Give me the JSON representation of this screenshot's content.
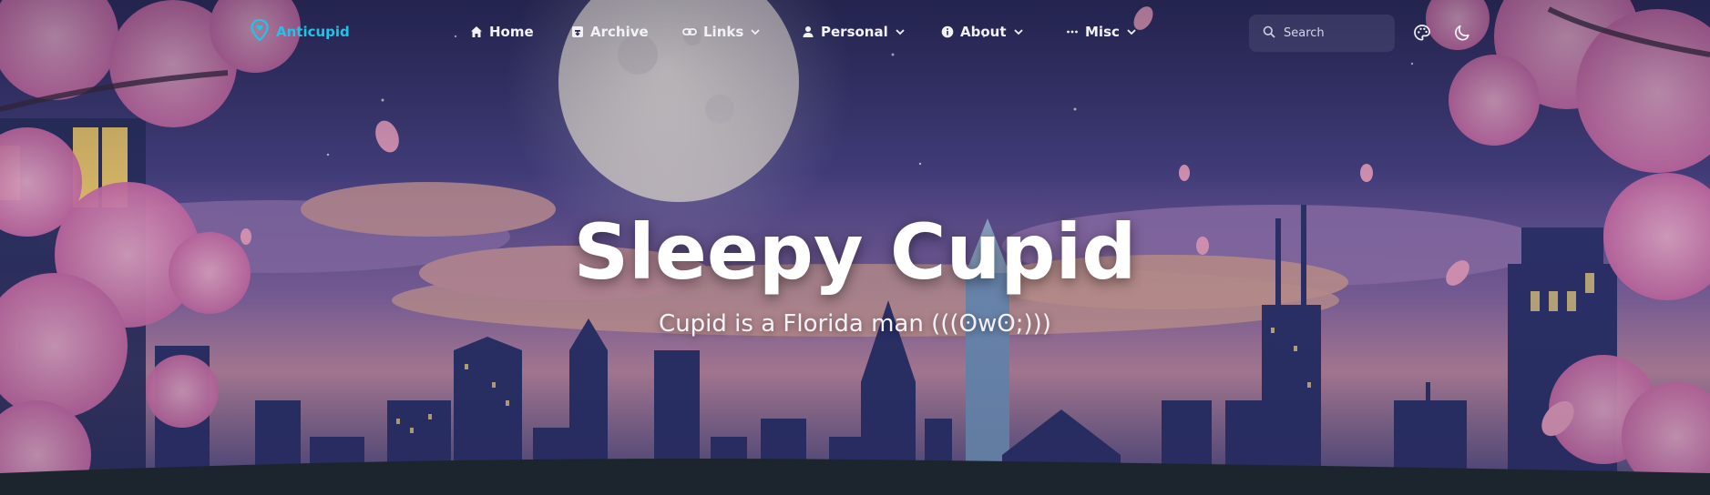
{
  "brand": {
    "label": "Anticupid",
    "icon": "map-pin-heart-icon",
    "color": "#22c3e6"
  },
  "nav": {
    "home": {
      "label": "Home",
      "icon": "home-icon"
    },
    "archive": {
      "label": "Archive",
      "icon": "archive-icon"
    },
    "links": {
      "label": "Links",
      "icon": "link-icon"
    },
    "personal": {
      "label": "Personal",
      "icon": "user-icon"
    },
    "about": {
      "label": "About",
      "icon": "info-icon"
    },
    "misc": {
      "label": "Misc",
      "icon": "ellipsis-icon"
    }
  },
  "search": {
    "placeholder": "Search",
    "icon": "search-icon"
  },
  "actions": {
    "theme_palette": "palette-icon",
    "dark_mode": "moon-icon"
  },
  "hero": {
    "title": "Sleepy Cupid",
    "subtitle": "Cupid is a Florida man (((ʘwʘ;)))"
  }
}
